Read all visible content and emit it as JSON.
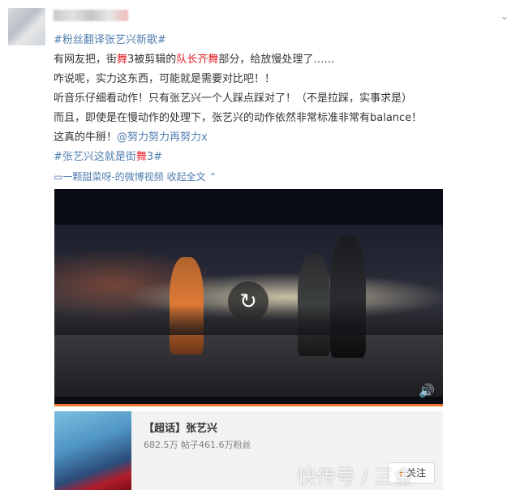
{
  "post": {
    "lines": [
      {
        "tag": "#粉丝翻译张艺兴新歌#"
      },
      {
        "a": "有网友把，街",
        "b": "舞",
        "c": "3被剪辑的",
        "d": "队长齐舞",
        "e": "部分，给放慢处理了……"
      },
      {
        "text": "咋说呢，实力这东西，可能就是需要对比吧！！"
      },
      {
        "text": "听音乐仔细看动作！只有张艺兴一个人踩点踩对了！（不是拉踩，实事求是）"
      },
      {
        "text": "而且，即使是在慢动作的处理下，张艺兴的动作依然非常标准非常有balance！"
      },
      {
        "a": "这真的牛掰！",
        "link": "@努力努力再努力x"
      },
      {
        "a": "#张艺兴这就是街",
        "b": "舞",
        "c": "3#"
      }
    ],
    "video_source": "一颗甜菜呀-的微博视频",
    "collapse_label": "收起全文"
  },
  "video": {
    "replay_icon": "replay-icon",
    "volume_icon": "volume-icon",
    "progress": 1.0
  },
  "card": {
    "title": "【超话】张艺兴",
    "stats": "682.5万  帖子461.6万粉丝",
    "follow_label": "关注"
  },
  "watermark": "快传号 / 三金"
}
